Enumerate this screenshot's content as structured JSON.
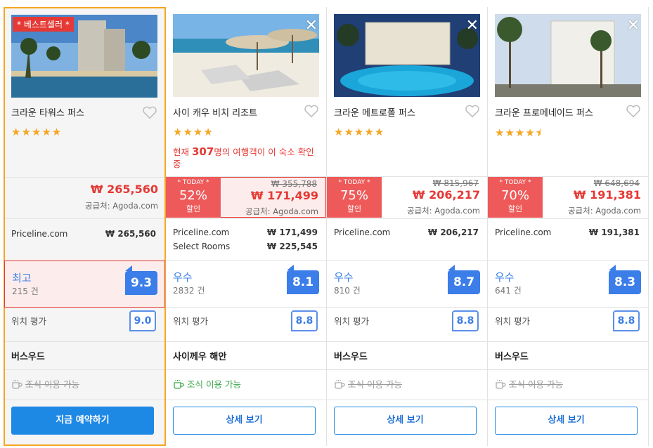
{
  "hotels": [
    {
      "badge": "* 베스트셀러 *",
      "name": "크라운 타워스 퍼스",
      "stars": "★★★★★",
      "price": "₩ 265,560",
      "supplier": "공급처: Agoda.com",
      "vendors": [
        {
          "name": "Priceline.com",
          "price": "₩ 265,560"
        }
      ],
      "rating_label": "최고",
      "rating_count": "215 건",
      "rating_score": "9.3",
      "location_label": "위치 평가",
      "location_score": "9.0",
      "area": "버스우드",
      "breakfast": "조식 이용 가능",
      "breakfast_available": false,
      "button": "지금 예약하기"
    },
    {
      "close": "✕",
      "name": "사이 캐우 비치 리조트",
      "stars": "★★★★",
      "notice_prefix": "현재 ",
      "notice_count": "307",
      "notice_suffix": "명의 여행객이 이 숙소 확인중",
      "today_label": "* TODAY *",
      "discount": "52%",
      "discount_label": "할인",
      "old_price": "₩ 355,788",
      "price": "₩ 171,499",
      "supplier": "공급처: Agoda.com",
      "vendors": [
        {
          "name": "Priceline.com",
          "price": "₩ 171,499"
        },
        {
          "name": "Select Rooms",
          "price": "₩ 225,545"
        }
      ],
      "rating_label": "우수",
      "rating_count": "2832 건",
      "rating_score": "8.1",
      "location_label": "위치 평가",
      "location_score": "8.8",
      "area": "사이께우 해안",
      "breakfast": "조식 이용 가능",
      "breakfast_available": true,
      "button": "상세 보기"
    },
    {
      "close": "✕",
      "name": "크라운 메트로폴 퍼스",
      "stars": "★★★★★",
      "today_label": "* TODAY *",
      "discount": "75%",
      "discount_label": "할인",
      "old_price": "₩ 815,967",
      "price": "₩ 206,217",
      "supplier": "공급처: Agoda.com",
      "vendors": [
        {
          "name": "Priceline.com",
          "price": "₩ 206,217"
        }
      ],
      "rating_label": "우수",
      "rating_count": "810 건",
      "rating_score": "8.7",
      "location_label": "위치 평가",
      "location_score": "8.8",
      "area": "버스우드",
      "breakfast": "조식 이용 가능",
      "breakfast_available": false,
      "button": "상세 보기"
    },
    {
      "close": "✕",
      "name": "크라운 프로메네이드 퍼스",
      "stars": "★★★★⯨",
      "today_label": "* TODAY *",
      "discount": "70%",
      "discount_label": "할인",
      "old_price": "₩ 648,694",
      "price": "₩ 191,381",
      "supplier": "공급처: Agoda.com",
      "vendors": [
        {
          "name": "Priceline.com",
          "price": "₩ 191,381"
        }
      ],
      "rating_label": "우수",
      "rating_count": "641 건",
      "rating_score": "8.3",
      "location_label": "위치 평가",
      "location_score": "8.8",
      "area": "버스우드",
      "breakfast": "조식 이용 가능",
      "breakfast_available": false,
      "button": "상세 보기"
    }
  ],
  "colors": {
    "accent": "#1e88e5",
    "sale": "#e53935",
    "rating": "#3b7de9",
    "best_border": "#f5a623"
  }
}
